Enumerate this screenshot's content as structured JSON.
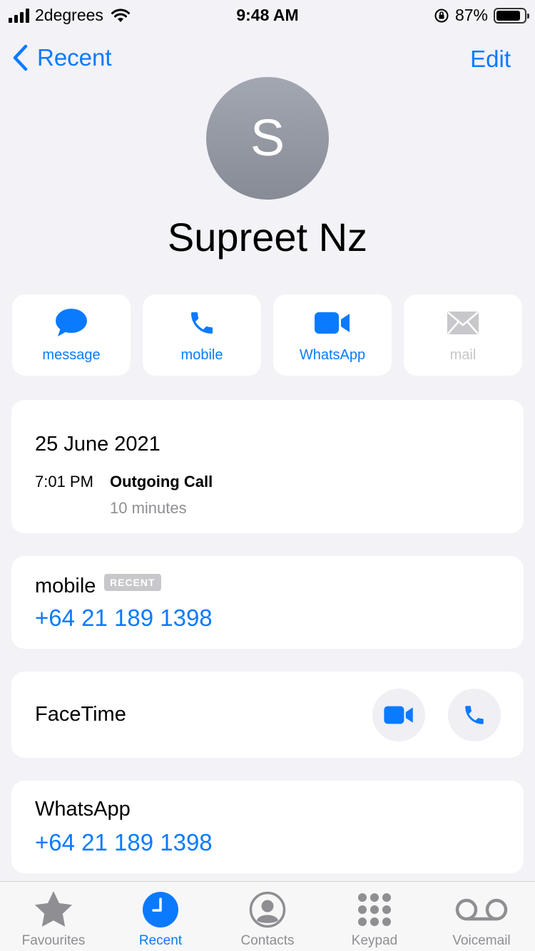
{
  "status": {
    "carrier": "2degrees",
    "time": "9:48 AM",
    "battery_pct": "87%",
    "battery_level": 0.87
  },
  "nav": {
    "back_label": "Recent",
    "edit_label": "Edit"
  },
  "contact": {
    "initial": "S",
    "name": "Supreet Nz"
  },
  "actions": [
    {
      "label": "message",
      "icon": "message-bubble-icon",
      "enabled": true
    },
    {
      "label": "mobile",
      "icon": "phone-icon",
      "enabled": true
    },
    {
      "label": "WhatsApp",
      "icon": "video-icon",
      "enabled": true
    },
    {
      "label": "mail",
      "icon": "mail-icon",
      "enabled": false
    }
  ],
  "call_log": {
    "date": "25 June 2021",
    "time": "7:01 PM",
    "type": "Outgoing Call",
    "duration": "10 minutes"
  },
  "mobile": {
    "label": "mobile",
    "badge": "RECENT",
    "number": "+64 21 189 1398"
  },
  "facetime": {
    "label": "FaceTime"
  },
  "whatsapp": {
    "label": "WhatsApp",
    "number": "+64 21 189 1398"
  },
  "tabs": [
    {
      "label": "Favourites",
      "icon": "star-icon",
      "active": false
    },
    {
      "label": "Recent",
      "icon": "clock-icon",
      "active": true
    },
    {
      "label": "Contacts",
      "icon": "person-circle-icon",
      "active": false
    },
    {
      "label": "Keypad",
      "icon": "keypad-icon",
      "active": false
    },
    {
      "label": "Voicemail",
      "icon": "voicemail-icon",
      "active": false
    }
  ],
  "colors": {
    "accent": "#0a7aff",
    "background": "#f2f2f7",
    "inactive": "#8e8e93"
  }
}
